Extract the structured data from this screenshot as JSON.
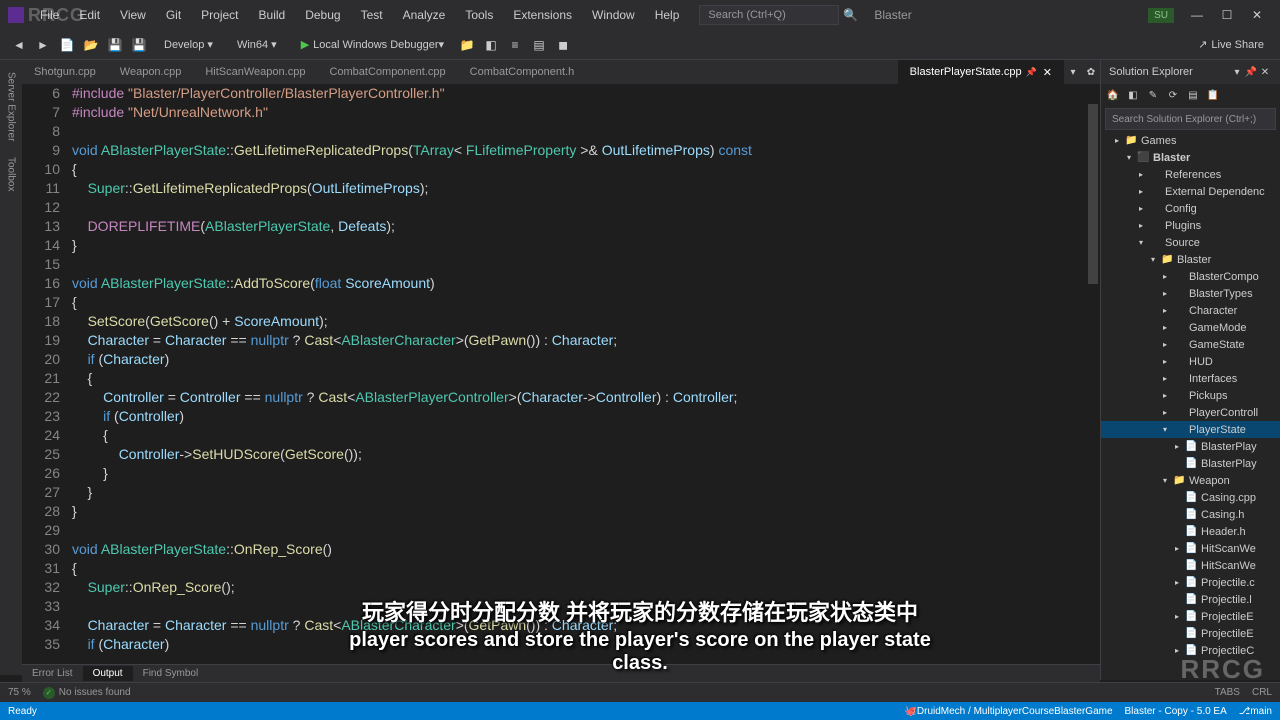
{
  "titlebar": {
    "menus": [
      "File",
      "Edit",
      "View",
      "Git",
      "Project",
      "Build",
      "Debug",
      "Test",
      "Analyze",
      "Tools",
      "Extensions",
      "Window",
      "Help"
    ],
    "search_placeholder": "Search (Ctrl+Q)",
    "project_name": "Blaster",
    "user_badge": "SU"
  },
  "toolbar": {
    "config": "Develop",
    "platform": "Win64",
    "debugger": "Local Windows Debugger",
    "liveshare": "Live Share"
  },
  "left_tabs": [
    "Server Explorer",
    "Toolbox"
  ],
  "file_tabs": [
    {
      "label": "Shotgun.cpp",
      "active": false
    },
    {
      "label": "Weapon.cpp",
      "active": false
    },
    {
      "label": "HitScanWeapon.cpp",
      "active": false
    },
    {
      "label": "CombatComponent.cpp",
      "active": false
    },
    {
      "label": "CombatComponent.h",
      "active": false
    },
    {
      "label": "BlasterPlayerState.cpp",
      "active": true
    }
  ],
  "code_lines": [
    {
      "n": 6,
      "html": "<span class='macro'>#include</span> <span class='str'>\"Blaster/PlayerController/BlasterPlayerController.h\"</span>"
    },
    {
      "n": 7,
      "html": "<span class='macro'>#include</span> <span class='str'>\"Net/UnrealNetwork.h\"</span>"
    },
    {
      "n": 8,
      "html": ""
    },
    {
      "n": 9,
      "html": "<span class='kw'>void</span> <span class='type'>ABlasterPlayerState</span>::<span class='fn'>GetLifetimeReplicatedProps</span>(<span class='type'>TArray</span>&lt; <span class='type'>FLifetimeProperty</span> &gt;&amp; <span class='param'>OutLifetimeProps</span>) <span class='kw'>const</span>"
    },
    {
      "n": 10,
      "html": "{"
    },
    {
      "n": 11,
      "html": "    <span class='type'>Super</span>::<span class='fn'>GetLifetimeReplicatedProps</span>(<span class='param'>OutLifetimeProps</span>);"
    },
    {
      "n": 12,
      "html": ""
    },
    {
      "n": 13,
      "html": "    <span class='macro'>DOREPLIFETIME</span>(<span class='type'>ABlasterPlayerState</span>, <span class='param'>Defeats</span>);"
    },
    {
      "n": 14,
      "html": "}"
    },
    {
      "n": 15,
      "html": ""
    },
    {
      "n": 16,
      "html": "<span class='kw'>void</span> <span class='type'>ABlasterPlayerState</span>::<span class='fn'>AddToScore</span>(<span class='kw'>float</span> <span class='param'>ScoreAmount</span>)"
    },
    {
      "n": 17,
      "html": "{"
    },
    {
      "n": 18,
      "html": "    <span class='fn'>SetScore</span>(<span class='fn'>GetScore</span>() + <span class='param'>ScoreAmount</span>);"
    },
    {
      "n": 19,
      "html": "    <span class='param'>Character</span> = <span class='param'>Character</span> == <span class='kw'>nullptr</span> ? <span class='fn'>Cast</span>&lt;<span class='type'>ABlasterCharacter</span>&gt;(<span class='fn'>GetPawn</span>()) : <span class='param'>Character</span>;"
    },
    {
      "n": 20,
      "html": "    <span class='kw'>if</span> (<span class='param'>Character</span>)"
    },
    {
      "n": 21,
      "html": "    {"
    },
    {
      "n": 22,
      "html": "        <span class='param'>Controller</span> = <span class='param'>Controller</span> == <span class='kw'>nullptr</span> ? <span class='fn'>Cast</span>&lt;<span class='type'>ABlasterPlayerController</span>&gt;(<span class='param'>Character</span>-&gt;<span class='param'>Controller</span>) : <span class='param'>Controller</span>;"
    },
    {
      "n": 23,
      "html": "        <span class='kw'>if</span> (<span class='param'>Controller</span>)"
    },
    {
      "n": 24,
      "html": "        {"
    },
    {
      "n": 25,
      "html": "            <span class='param'>Controller</span>-&gt;<span class='fn'>SetHUDScore</span>(<span class='fn'>GetScore</span>());"
    },
    {
      "n": 26,
      "html": "        }"
    },
    {
      "n": 27,
      "html": "    }"
    },
    {
      "n": 28,
      "html": "}"
    },
    {
      "n": 29,
      "html": ""
    },
    {
      "n": 30,
      "html": "<span class='kw'>void</span> <span class='type'>ABlasterPlayerState</span>::<span class='fn'>OnRep_Score</span>()"
    },
    {
      "n": 31,
      "html": "{"
    },
    {
      "n": 32,
      "html": "    <span class='type'>Super</span>::<span class='fn'>OnRep_Score</span>();"
    },
    {
      "n": 33,
      "html": ""
    },
    {
      "n": 34,
      "html": "    <span class='param'>Character</span> = <span class='param'>Character</span> == <span class='kw'>nullptr</span> ? <span class='fn'>Cast</span>&lt;<span class='type'>ABlasterCharacter</span>&gt;(<span class='fn'>GetPawn</span>()) : <span class='param'>Character</span>;"
    },
    {
      "n": 35,
      "html": "    <span class='kw'>if</span> (<span class='param'>Character</span>)"
    }
  ],
  "solution_explorer": {
    "title": "Solution Explorer",
    "search_placeholder": "Search Solution Explorer (Ctrl+;)",
    "tree": [
      {
        "indent": 1,
        "expand": "▸",
        "icon": "📁",
        "label": "Games"
      },
      {
        "indent": 2,
        "expand": "▾",
        "icon": "⬛",
        "label": "Blaster",
        "bold": true
      },
      {
        "indent": 3,
        "expand": "▸",
        "icon": "",
        "label": "References"
      },
      {
        "indent": 3,
        "expand": "▸",
        "icon": "",
        "label": "External Dependenc"
      },
      {
        "indent": 3,
        "expand": "▸",
        "icon": "",
        "label": "Config"
      },
      {
        "indent": 3,
        "expand": "▸",
        "icon": "",
        "label": "Plugins"
      },
      {
        "indent": 3,
        "expand": "▾",
        "icon": "",
        "label": "Source"
      },
      {
        "indent": 4,
        "expand": "▾",
        "icon": "📁",
        "label": "Blaster"
      },
      {
        "indent": 5,
        "expand": "▸",
        "icon": "",
        "label": "BlasterCompo"
      },
      {
        "indent": 5,
        "expand": "▸",
        "icon": "",
        "label": "BlasterTypes"
      },
      {
        "indent": 5,
        "expand": "▸",
        "icon": "",
        "label": "Character"
      },
      {
        "indent": 5,
        "expand": "▸",
        "icon": "",
        "label": "GameMode"
      },
      {
        "indent": 5,
        "expand": "▸",
        "icon": "",
        "label": "GameState"
      },
      {
        "indent": 5,
        "expand": "▸",
        "icon": "",
        "label": "HUD"
      },
      {
        "indent": 5,
        "expand": "▸",
        "icon": "",
        "label": "Interfaces"
      },
      {
        "indent": 5,
        "expand": "▸",
        "icon": "",
        "label": "Pickups"
      },
      {
        "indent": 5,
        "expand": "▸",
        "icon": "",
        "label": "PlayerControll"
      },
      {
        "indent": 5,
        "expand": "▾",
        "icon": "",
        "label": "PlayerState",
        "selected": true
      },
      {
        "indent": 6,
        "expand": "▸",
        "icon": "📄",
        "label": "BlasterPlay"
      },
      {
        "indent": 6,
        "expand": "",
        "icon": "📄",
        "label": "BlasterPlay"
      },
      {
        "indent": 5,
        "expand": "▾",
        "icon": "📁",
        "label": "Weapon"
      },
      {
        "indent": 6,
        "expand": "",
        "icon": "📄",
        "label": "Casing.cpp"
      },
      {
        "indent": 6,
        "expand": "",
        "icon": "📄",
        "label": "Casing.h"
      },
      {
        "indent": 6,
        "expand": "",
        "icon": "📄",
        "label": "Header.h"
      },
      {
        "indent": 6,
        "expand": "▸",
        "icon": "📄",
        "label": "HitScanWe"
      },
      {
        "indent": 6,
        "expand": "",
        "icon": "📄",
        "label": "HitScanWe"
      },
      {
        "indent": 6,
        "expand": "▸",
        "icon": "📄",
        "label": "Projectile.c"
      },
      {
        "indent": 6,
        "expand": "",
        "icon": "📄",
        "label": "Projectile.l"
      },
      {
        "indent": 6,
        "expand": "▸",
        "icon": "📄",
        "label": "ProjectileE"
      },
      {
        "indent": 6,
        "expand": "",
        "icon": "📄",
        "label": "ProjectileE"
      },
      {
        "indent": 6,
        "expand": "▸",
        "icon": "📄",
        "label": "ProjectileC"
      }
    ]
  },
  "status": {
    "zoom": "75 %",
    "issues": "No issues found",
    "tabs": "TABS",
    "crlf": "CRL"
  },
  "bottom_tabs": [
    "Error List",
    "Output",
    "Find Symbol"
  ],
  "vs_status": {
    "ready": "Ready",
    "repo": "DruidMech / MultiplayerCourseBlasterGame",
    "project": "Blaster - Copy - 5.0 EA",
    "branch": "main"
  },
  "subtitle": {
    "line1": "玩家得分时分配分数 并将玩家的分数存储在玩家状态类中",
    "line2": "player scores and store the player's score on the player state class."
  },
  "watermark": "RRCG",
  "watermark_br": "RRCG"
}
